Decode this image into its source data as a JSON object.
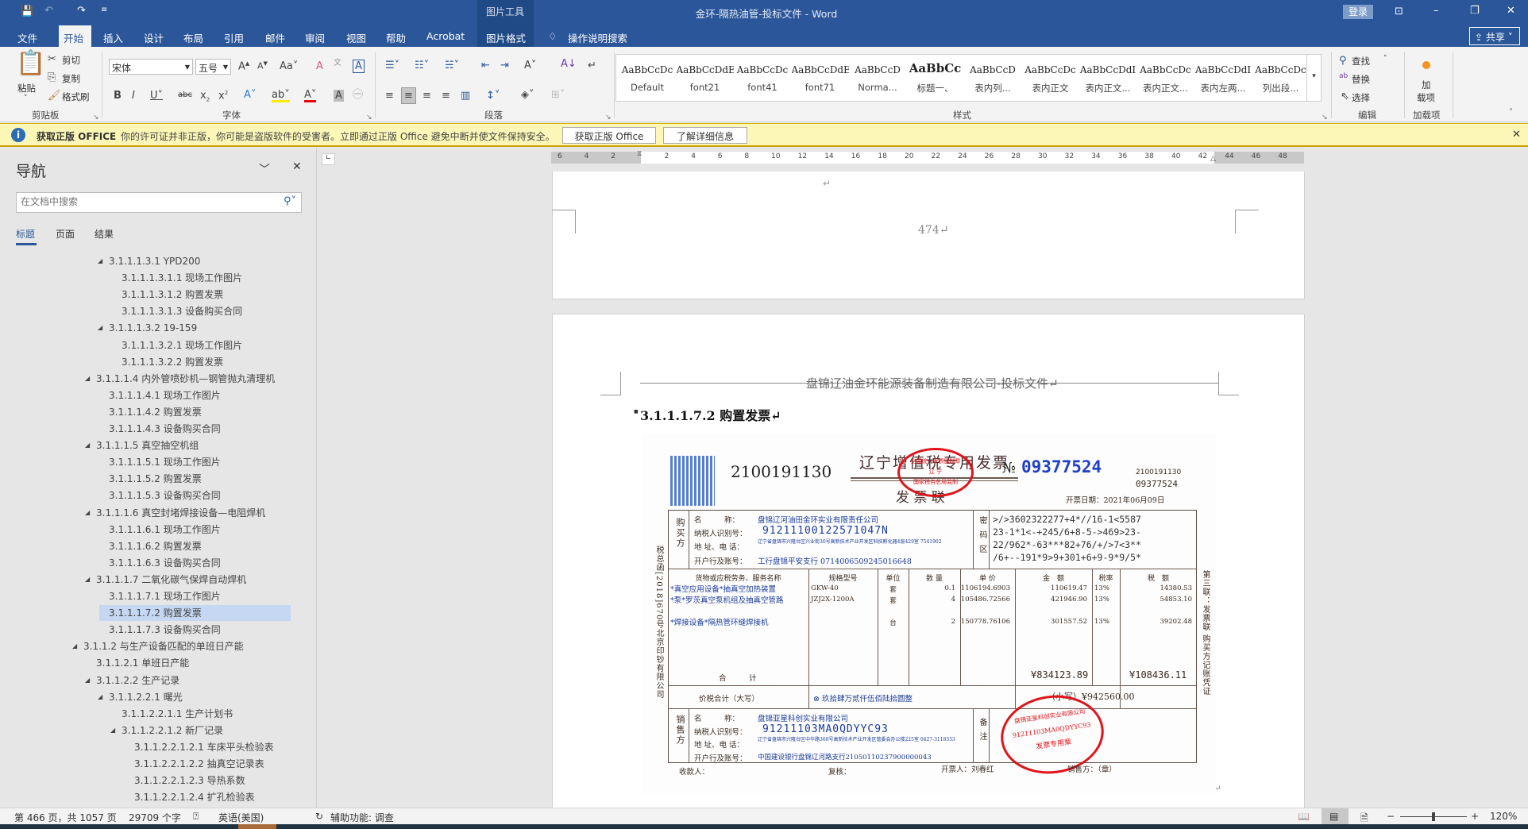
{
  "titlebar": {
    "title": "金环-隔热油管-投标文件  -  Word",
    "context_tab_group": "图片工具",
    "login": "登录",
    "share": "共享"
  },
  "tabs": [
    "文件",
    "开始",
    "插入",
    "设计",
    "布局",
    "引用",
    "邮件",
    "审阅",
    "视图",
    "帮助",
    "Acrobat",
    "图片格式"
  ],
  "tell_me": "操作说明搜索",
  "ribbon": {
    "clipboard": {
      "paste": "粘贴",
      "cut": "剪切",
      "copy": "复制",
      "format_painter": "格式刷",
      "label": "剪贴板"
    },
    "font": {
      "name": "宋体",
      "size": "五号",
      "label": "字体"
    },
    "paragraph": {
      "label": "段落"
    },
    "styles": {
      "label": "样式",
      "items": [
        {
          "preview": "AaBbCcDc",
          "name": "Default"
        },
        {
          "preview": "AaBbCcDdE",
          "name": "font21"
        },
        {
          "preview": "AaBbCcDc",
          "name": "font41"
        },
        {
          "preview": "AaBbCcDdEe",
          "name": "font71"
        },
        {
          "preview": "AaBbCcD",
          "name": "Norma..."
        },
        {
          "preview": "AaBbCc",
          "name": "标题一、"
        },
        {
          "preview": "AaBbCcD",
          "name": "表内列..."
        },
        {
          "preview": "AaBbCcDc",
          "name": "表内正文"
        },
        {
          "preview": "AaBbCcDdI",
          "name": "表内正文..."
        },
        {
          "preview": "AaBbCcDc",
          "name": "表内正文..."
        },
        {
          "preview": "AaBbCcDdI",
          "name": "表内左两..."
        },
        {
          "preview": "AaBbCcDc",
          "name": "列出段..."
        }
      ]
    },
    "editing": {
      "find": "查找",
      "replace": "替换",
      "select": "选择",
      "label": "编辑"
    },
    "addins": {
      "button_line1": "加",
      "button_line2": "载项",
      "label": "加载项"
    }
  },
  "message_bar": {
    "title": "获取正版 OFFICE",
    "text": "你的许可证并非正版，你可能是盗版软件的受害者。立即通过正版 Office 避免中断并使文件保持安全。",
    "btn_get": "获取正版 Office",
    "btn_learn": "了解详细信息"
  },
  "nav": {
    "title": "导航",
    "search_placeholder": "在文档中搜索",
    "tabs": [
      "标题",
      "页面",
      "结果"
    ],
    "items": [
      {
        "label": "3.1.1.1.3.1 YPD200",
        "level": 2,
        "exp": true
      },
      {
        "label": "3.1.1.1.3.1.1 现场工作图片",
        "level": 3
      },
      {
        "label": "3.1.1.1.3.1.2 购置发票",
        "level": 3
      },
      {
        "label": "3.1.1.1.3.1.3 设备购买合同",
        "level": 3
      },
      {
        "label": "3.1.1.1.3.2 19-159",
        "level": 2,
        "exp": true
      },
      {
        "label": "3.1.1.1.3.2.1 现场工作图片",
        "level": 3
      },
      {
        "label": "3.1.1.1.3.2.2 购置发票",
        "level": 3
      },
      {
        "label": "3.1.1.1.4 内外管喷砂机—钢管抛丸清理机",
        "level": 1,
        "exp": true
      },
      {
        "label": "3.1.1.1.4.1 现场工作图片",
        "level": 2
      },
      {
        "label": "3.1.1.1.4.2 购置发票",
        "level": 2
      },
      {
        "label": "3.1.1.1.4.3 设备购买合同",
        "level": 2
      },
      {
        "label": "3.1.1.1.5 真空抽空机组",
        "level": 1,
        "exp": true
      },
      {
        "label": "3.1.1.1.5.1 现场工作图片",
        "level": 2
      },
      {
        "label": "3.1.1.1.5.2 购置发票",
        "level": 2
      },
      {
        "label": "3.1.1.1.5.3 设备购买合同",
        "level": 2
      },
      {
        "label": "3.1.1.1.6 真空封堵焊接设备—电阻焊机",
        "level": 1,
        "exp": true
      },
      {
        "label": "3.1.1.1.6.1 现场工作图片",
        "level": 2
      },
      {
        "label": "3.1.1.1.6.2 购置发票",
        "level": 2
      },
      {
        "label": "3.1.1.1.6.3 设备购买合同",
        "level": 2
      },
      {
        "label": "3.1.1.1.7 二氧化碳气保焊自动焊机",
        "level": 1,
        "exp": true
      },
      {
        "label": "3.1.1.1.7.1 现场工作图片",
        "level": 2
      },
      {
        "label": "3.1.1.1.7.2 购置发票",
        "level": 2,
        "selected": true
      },
      {
        "label": "3.1.1.1.7.3 设备购买合同",
        "level": 2
      },
      {
        "label": "3.1.1.2 与生产设备匹配的单班日产能",
        "level": 0,
        "exp": true
      },
      {
        "label": "3.1.1.2.1 单班日产能",
        "level": 1
      },
      {
        "label": "3.1.1.2.2 生产记录",
        "level": 1,
        "exp": true
      },
      {
        "label": "3.1.1.2.2.1 曙光",
        "level": 2,
        "exp": true
      },
      {
        "label": "3.1.1.2.2.1.1 生产计划书",
        "level": 3
      },
      {
        "label": "3.1.1.2.2.1.2 新厂记录",
        "level": 3,
        "exp": true
      },
      {
        "label": "3.1.1.2.2.1.2.1 车床平头检验表",
        "level": 4
      },
      {
        "label": "3.1.1.2.2.1.2.2 抽真空记录表",
        "level": 4
      },
      {
        "label": "3.1.1.2.2.1.2.3 导热系数",
        "level": 4
      },
      {
        "label": "3.1.1.2.2.1.2.4 扩孔检验表",
        "level": 4
      }
    ]
  },
  "ruler": {
    "labels": [
      "6",
      "4",
      "2",
      "2",
      "4",
      "6",
      "8",
      "10",
      "12",
      "14",
      "16",
      "18",
      "20",
      "22",
      "24",
      "26",
      "28",
      "30",
      "32",
      "34",
      "36",
      "38",
      "40",
      "42",
      "44",
      "46",
      "48"
    ]
  },
  "document": {
    "page_number": "474↵",
    "mark": "↵",
    "header": "盘锦辽油金环能源装备制造有限公司-投标文件↵",
    "heading": "3.1.1.1.7.2 购置发票↵"
  },
  "invoice": {
    "code": "2100191130",
    "title": "辽宁增值税专用发票",
    "copy": "发 票 联",
    "no_prefix": "№",
    "number": "09377524",
    "code_small": "2100191130",
    "number_small": "09377524",
    "date": "开票日期：2021年06月09日",
    "stamp_top": "全国统一发票监制章",
    "stamp_mid": "辽   宁",
    "stamp_bottom": "国家税务总局监制",
    "buyer_label": "购买方",
    "buyer": {
      "name_label": "名　　　称：",
      "name": "盘锦辽河油田金环实业有限责任公司",
      "tax_label": "纳税人识别号：",
      "tax": "91211100122571047N",
      "addr_label": "地 址、电 话：",
      "addr": "辽宁省盘锦市兴隆台区兴业街30号高新技术产业开发区科技孵化器4层429室 7541902",
      "bank_label": "开户行及账号：",
      "bank": "工行盘锦平安支行 0714006509245016648"
    },
    "cipher_label": "密码区",
    "cipher": [
      ">/>3602322277+4*//16-1<5587",
      "23-1*1<-+245/6+8-5->469>23-",
      "22/962*-63***82+76/+/>7<3**",
      "/6+--191*9>9+301+6+9-9*9/5*"
    ],
    "headers": [
      "货物或应税劳务、服务名称",
      "规格型号",
      "单位",
      "数 量",
      "单 价",
      "金　额",
      "税率",
      "税　额"
    ],
    "rows": [
      [
        "*真空应用设备*抽真空加热装置",
        "GKW-40",
        "套",
        "0.1",
        "1106194.6903",
        "110619.47",
        "13%",
        "14380.53"
      ],
      [
        "*泵*罗茨真空泵机组及抽真空管路",
        "JZJ2X-1200A",
        "套",
        "4",
        "105486.72566",
        "421946.90",
        "13%",
        "54853.10"
      ],
      [
        "*焊接设备*隔热管环缝焊接机",
        "",
        "台",
        "2",
        "150778.76106",
        "301557.52",
        "13%",
        "39202.48"
      ]
    ],
    "sum_label": "合　　　计",
    "sum_amount": "¥834123.89",
    "sum_tax": "¥108436.11",
    "total_label": "价税合计（大写）",
    "total_words": "⊗ 玖拾肆万贰仟伍佰陆拾圆整",
    "total_small": "（小写）¥942560.00",
    "seller_label": "销售方",
    "seller": {
      "name_label": "名　　　称：",
      "name": "盘锦亚星科创实业有限公司",
      "tax_label": "纳税人识别号：",
      "tax": "91211103MA0QDYYC93",
      "addr_label": "地 址、电 话：",
      "addr": "辽宁省盘锦市兴隆台区中华路360号高新技术产业开发区管委会办公楼225室 0427-3118553",
      "bank_label": "开户行及账号：",
      "bank": "中国建设银行盘锦辽河路支行21050110237900000043"
    },
    "remark_label": "备注",
    "seller_stamp_name": "盘锦亚星科创实业有限公司",
    "seller_stamp_tax": "91211103MA0QDYYC93",
    "seller_stamp_bottom": "发票专用章",
    "payee": "收款人：",
    "reviewer": "复核：",
    "issuer": "开票人：刘春红",
    "seller_sign": "销售方：（章）",
    "left_margin": "税总函[2018]670号北京印钞有限公司",
    "right_margin": "第三联：发票联 购买方记账凭证"
  },
  "status": {
    "page": "第 466 页，共 1057 页",
    "words": "29709 个字",
    "language": "英语(美国)",
    "accessibility": "辅助功能: 调查",
    "zoom": "120%",
    "zoom_fraction": 0.5
  },
  "colors": {
    "brand": "#2b579a",
    "selected": "#c5d7f2",
    "message": "#fcf7b6"
  }
}
